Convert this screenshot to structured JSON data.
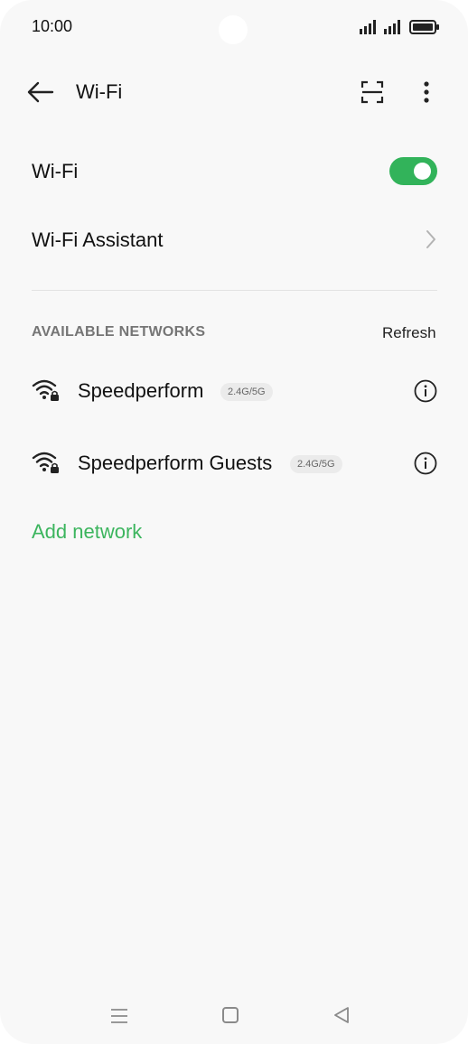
{
  "status_bar": {
    "time": "10:00",
    "icons": [
      "signal-icon",
      "signal-icon",
      "battery-icon"
    ]
  },
  "app_bar": {
    "title": "Wi-Fi",
    "icons": [
      "back-arrow-icon",
      "scan-icon",
      "more-vert-icon"
    ]
  },
  "settings": {
    "wifi_label": "Wi-Fi",
    "wifi_enabled": true,
    "assistant_label": "Wi-Fi Assistant"
  },
  "networks_section": {
    "title": "AVAILABLE NETWORKS",
    "refresh_label": "Refresh",
    "networks": [
      {
        "name": "Speedperform",
        "band": "2.4G/5G",
        "secured": true
      },
      {
        "name": "Speedperform Guests",
        "band": "2.4G/5G",
        "secured": true
      }
    ]
  },
  "add_network_label": "Add network",
  "colors": {
    "accent": "#3cb55e",
    "toggle_on": "#32b35a",
    "background": "#f8f8f8"
  },
  "nav_bar": {
    "icons": [
      "recent-apps-icon",
      "home-icon",
      "back-triangle-icon"
    ]
  }
}
